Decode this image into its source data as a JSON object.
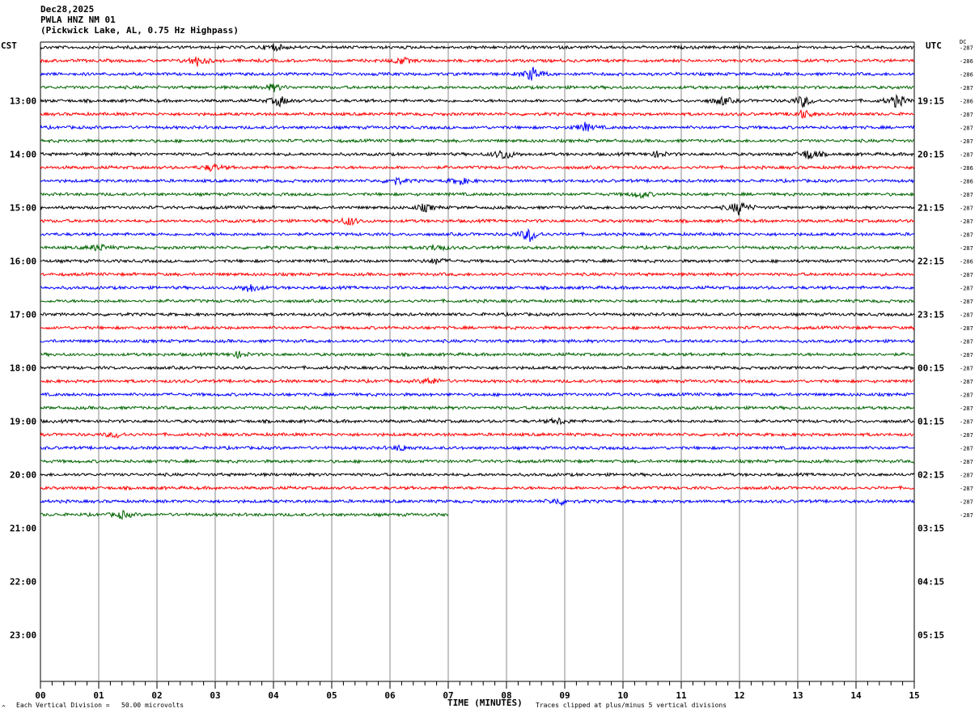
{
  "header": {
    "date": "Dec28,2025",
    "station": "PWLA HNZ NM 01",
    "location": "(Pickwick Lake, AL, 0.75 Hz Highpass)"
  },
  "left_axis_label": "CST",
  "right_axis_label": "UTC",
  "dc_label": "DC",
  "footer": {
    "scale_note": "Each Vertical Division =   50.00 microvolts",
    "clip_note": "Traces clipped at plus/minus 5 vertical divisions",
    "corner_mark": "^"
  },
  "chart_data": {
    "type": "line",
    "title": "PWLA HNZ NM 01",
    "xlabel": "TIME (MINUTES)",
    "ylabel": "",
    "xlim": [
      0,
      15
    ],
    "x_ticks": [
      "00",
      "01",
      "02",
      "03",
      "04",
      "05",
      "06",
      "07",
      "08",
      "09",
      "10",
      "11",
      "12",
      "13",
      "14",
      "15"
    ],
    "cst_hours": [
      "13:00",
      "14:00",
      "15:00",
      "16:00",
      "17:00",
      "18:00",
      "19:00",
      "20:00",
      "21:00",
      "22:00",
      "23:00"
    ],
    "utc_hours": [
      "19:15",
      "20:15",
      "21:15",
      "22:15",
      "23:15",
      "00:15",
      "01:15",
      "02:15",
      "03:15",
      "04:15",
      "05:15"
    ],
    "trace_colors": [
      "#000000",
      "#ff0000",
      "#0000ff",
      "#006400"
    ],
    "trace_count": 36,
    "last_trace_end_minute": 7.0,
    "dc_offsets": [
      "-287",
      "-286",
      "-286",
      "-287",
      "-286",
      "-287",
      "-287",
      "-287",
      "-287",
      "-286",
      "-286",
      "-287",
      "-287",
      "-287",
      "-287",
      "-287",
      "-286",
      "-287",
      "-287",
      "-287",
      "-287",
      "-287",
      "-287",
      "-287",
      "-287",
      "-287",
      "-287",
      "-287",
      "-287",
      "-287",
      "-287",
      "-287",
      "-287",
      "-287",
      "-287",
      "-287"
    ],
    "events": [
      {
        "trace": 0,
        "minute": 4.0,
        "amp": 0.5
      },
      {
        "trace": 1,
        "minute": 2.7,
        "amp": 0.7
      },
      {
        "trace": 1,
        "minute": 6.2,
        "amp": 0.5
      },
      {
        "trace": 2,
        "minute": 8.45,
        "amp": 1.0
      },
      {
        "trace": 3,
        "minute": 4.0,
        "amp": 0.5
      },
      {
        "trace": 4,
        "minute": 4.1,
        "amp": 0.7
      },
      {
        "trace": 4,
        "minute": 11.7,
        "amp": 0.6
      },
      {
        "trace": 4,
        "minute": 13.1,
        "amp": 0.8
      },
      {
        "trace": 4,
        "minute": 14.7,
        "amp": 0.9
      },
      {
        "trace": 5,
        "minute": 13.1,
        "amp": 0.6
      },
      {
        "trace": 6,
        "minute": 9.35,
        "amp": 0.6
      },
      {
        "trace": 8,
        "minute": 7.95,
        "amp": 0.8
      },
      {
        "trace": 8,
        "minute": 13.2,
        "amp": 0.8
      },
      {
        "trace": 8,
        "minute": 10.6,
        "amp": 0.4
      },
      {
        "trace": 9,
        "minute": 2.95,
        "amp": 0.5
      },
      {
        "trace": 10,
        "minute": 6.1,
        "amp": 0.5
      },
      {
        "trace": 10,
        "minute": 7.2,
        "amp": 0.5
      },
      {
        "trace": 11,
        "minute": 10.3,
        "amp": 0.5
      },
      {
        "trace": 12,
        "minute": 12.0,
        "amp": 1.0
      },
      {
        "trace": 12,
        "minute": 6.6,
        "amp": 0.5
      },
      {
        "trace": 13,
        "minute": 5.3,
        "amp": 0.6
      },
      {
        "trace": 14,
        "minute": 8.4,
        "amp": 1.0
      },
      {
        "trace": 15,
        "minute": 1.0,
        "amp": 0.5
      },
      {
        "trace": 15,
        "minute": 6.8,
        "amp": 0.5
      },
      {
        "trace": 16,
        "minute": 6.8,
        "amp": 0.4
      },
      {
        "trace": 18,
        "minute": 3.6,
        "amp": 0.6
      },
      {
        "trace": 23,
        "minute": 3.4,
        "amp": 0.4
      },
      {
        "trace": 25,
        "minute": 6.7,
        "amp": 0.5
      },
      {
        "trace": 28,
        "minute": 8.9,
        "amp": 0.4
      },
      {
        "trace": 29,
        "minute": 1.3,
        "amp": 0.4
      },
      {
        "trace": 30,
        "minute": 6.2,
        "amp": 0.4
      },
      {
        "trace": 34,
        "minute": 8.9,
        "amp": 0.5
      },
      {
        "trace": 35,
        "minute": 1.4,
        "amp": 0.5
      }
    ]
  }
}
